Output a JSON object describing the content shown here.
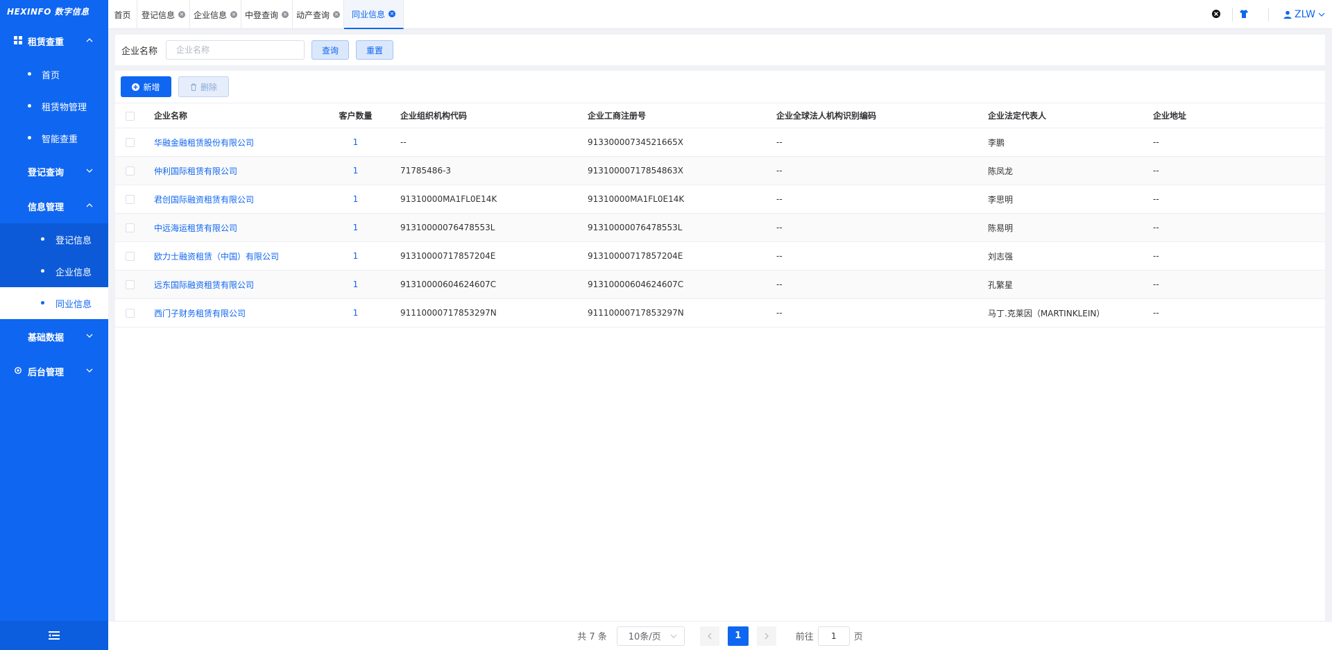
{
  "sidebar": {
    "logo": "HEXINFO 数字信息",
    "groups": [
      {
        "label": "租赁查重",
        "expanded": true,
        "items": [
          "首页",
          "租赁物管理",
          "智能查重"
        ]
      },
      {
        "label": "登记查询",
        "expanded": false
      },
      {
        "label": "信息管理",
        "expanded": true,
        "items": [
          "登记信息",
          "企业信息",
          "同业信息"
        ],
        "active": "同业信息"
      },
      {
        "label": "基础数据",
        "expanded": false
      },
      {
        "label": "后台管理",
        "expanded": false
      }
    ]
  },
  "tabs": [
    {
      "label": "首页",
      "closable": false
    },
    {
      "label": "登记信息",
      "closable": true
    },
    {
      "label": "企业信息",
      "closable": true
    },
    {
      "label": "中登查询",
      "closable": true
    },
    {
      "label": "动产查询",
      "closable": true
    },
    {
      "label": "同业信息",
      "closable": true,
      "active": true
    }
  ],
  "header": {
    "user": "ZLW"
  },
  "search": {
    "label": "企业名称",
    "placeholder": "企业名称",
    "value": "",
    "query_label": "查询",
    "reset_label": "重置"
  },
  "toolbar": {
    "add_label": "新增",
    "delete_label": "删除"
  },
  "table": {
    "columns": [
      "企业名称",
      "客户数量",
      "企业组织机构代码",
      "企业工商注册号",
      "企业全球法人机构识别编码",
      "企业法定代表人",
      "企业地址"
    ],
    "rows": [
      [
        "华融金融租赁股份有限公司",
        "1",
        "--",
        "91330000734521665X",
        "--",
        "李鹏",
        "--"
      ],
      [
        "仲利国际租赁有限公司",
        "1",
        "71785486-3",
        "91310000717854863X",
        "--",
        "陈凤龙",
        "--"
      ],
      [
        "君创国际融资租赁有限公司",
        "1",
        "91310000MA1FL0E14K",
        "91310000MA1FL0E14K",
        "--",
        "李思明",
        "--"
      ],
      [
        "中远海运租赁有限公司",
        "1",
        "91310000076478553L",
        "91310000076478553L",
        "--",
        "陈易明",
        "--"
      ],
      [
        "欧力士融资租赁（中国）有限公司",
        "1",
        "91310000717857204E",
        "91310000717857204E",
        "--",
        "刘志强",
        "--"
      ],
      [
        "远东国际融资租赁有限公司",
        "1",
        "91310000604624607C",
        "91310000604624607C",
        "--",
        "孔繁星",
        "--"
      ],
      [
        "西门子财务租赁有限公司",
        "1",
        "91110000717853297N",
        "91110000717853297N",
        "--",
        "马丁.克莱因（MARTINKLEIN）",
        "--"
      ]
    ]
  },
  "pagination": {
    "total": "共 7 条",
    "page_size": "10条/页",
    "current_page": "1",
    "goto_label": "前往",
    "goto_value": "1",
    "page_suffix": "页"
  },
  "colors": {
    "primary": "#0f66f0",
    "sidebar": "#0f66f0"
  }
}
